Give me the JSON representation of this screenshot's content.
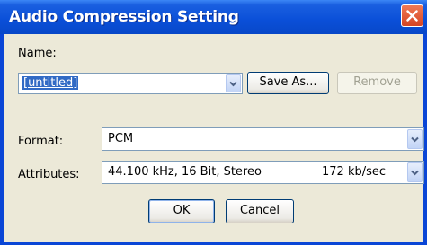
{
  "window": {
    "title": "Audio Compression Setting"
  },
  "name_section": {
    "label": "Name:",
    "value": "[untitled]",
    "save_as_label": "Save As...",
    "remove_label": "Remove"
  },
  "format": {
    "label": "Format:",
    "value": "PCM"
  },
  "attributes": {
    "label": "Attributes:",
    "value": "44.100 kHz, 16 Bit, Stereo",
    "rate": "172 kb/sec"
  },
  "buttons": {
    "ok": "OK",
    "cancel": "Cancel"
  },
  "icons": {
    "close": "close-icon",
    "dropdown": "chevron-down-icon"
  },
  "colors": {
    "titlebar": "#0a4fd8",
    "client": "#ece9d8",
    "selection": "#316ac5",
    "close": "#d54424"
  }
}
